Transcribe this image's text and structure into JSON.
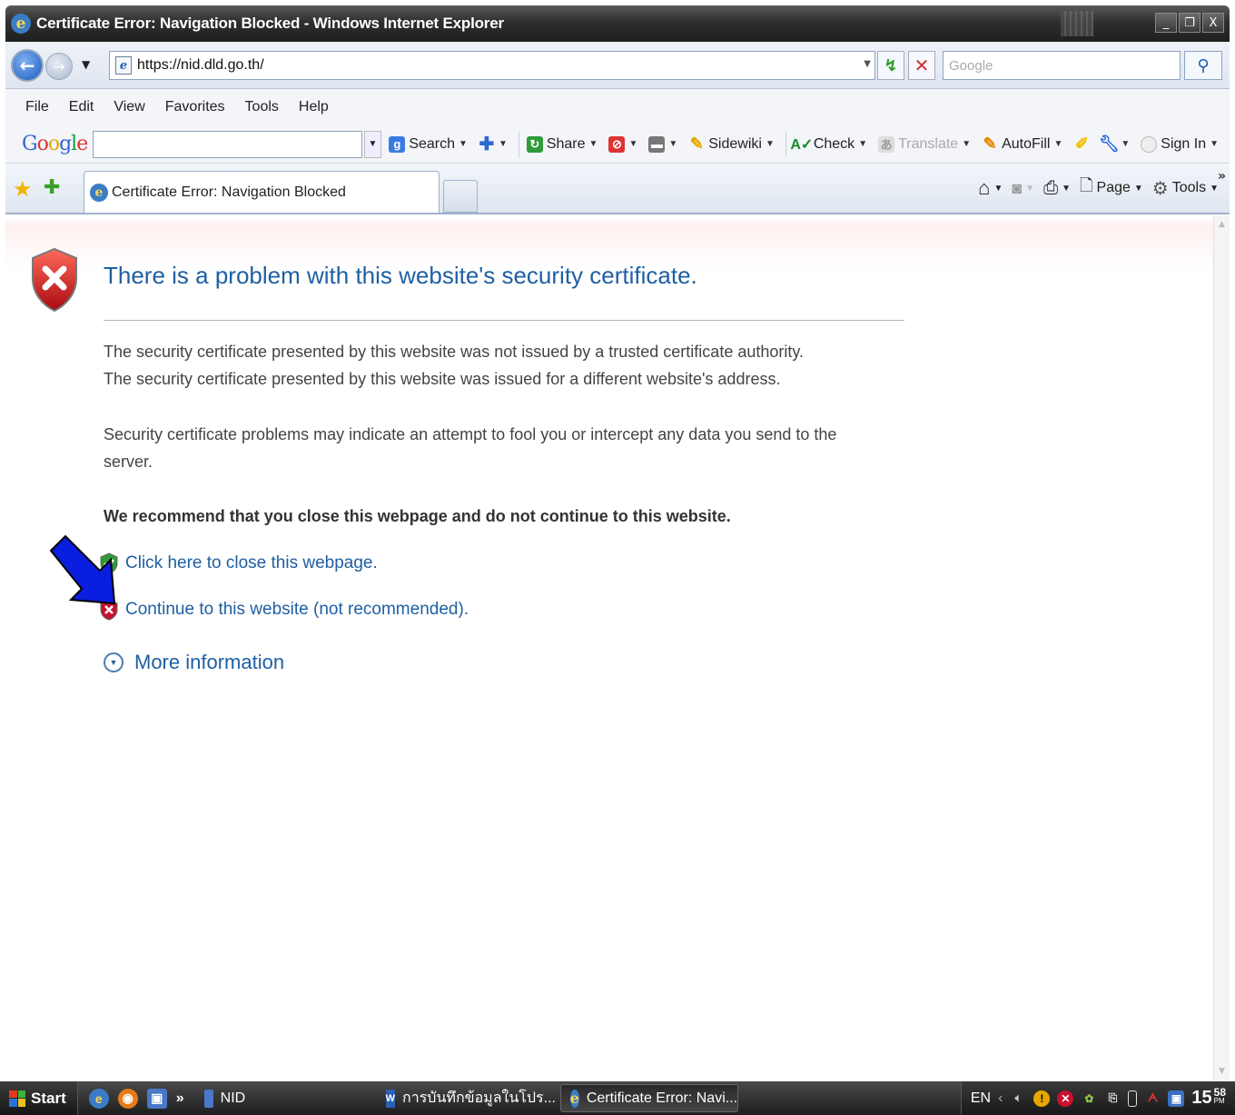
{
  "window": {
    "title": "Certificate Error: Navigation Blocked - Windows Internet Explorer",
    "minimize": "_",
    "restore": "❐",
    "close": "X"
  },
  "address_bar": {
    "url": "https://nid.dld.go.th/",
    "search_placeholder": "Google"
  },
  "menu": [
    "File",
    "Edit",
    "View",
    "Favorites",
    "Tools",
    "Help"
  ],
  "google_toolbar": {
    "logo": "Google",
    "items": {
      "search": "Search",
      "share": "Share",
      "sidewiki": "Sidewiki",
      "check": "Check",
      "translate": "Translate",
      "autofill": "AutoFill",
      "signin": "Sign In"
    }
  },
  "tab_bar": {
    "active_tab": "Certificate Error: Navigation Blocked",
    "commands": {
      "page": "Page",
      "tools": "Tools"
    },
    "overflow": "»"
  },
  "content": {
    "headline": "There is a problem with this website's security certificate.",
    "para1": "The security certificate presented by this website was not issued by a trusted certificate authority.",
    "para2": "The security certificate presented by this website was issued for a different website's address.",
    "para3": "Security certificate problems may indicate an attempt to fool you or intercept any data you send to the server.",
    "recommend": "We recommend that you close this webpage and do not continue to this website.",
    "close_link": "Click here to close this webpage.",
    "continue_link": "Continue to this website (not recommended).",
    "more_info": "More information"
  },
  "taskbar": {
    "start": "Start",
    "quicklaunch_more": "»",
    "buttons": {
      "nid": "NID",
      "word": "การบันทึกข้อมูลในโปร...",
      "cert": "Certificate Error: Navi..."
    },
    "tray": {
      "lang": "EN",
      "time_hour_min": "15",
      "time_sup_min": "58",
      "time_ampm": "PM"
    }
  },
  "colors": {
    "link": "#1f5fa3",
    "error_red": "#c8102e",
    "ok_green": "#2e9a3a",
    "arrow_blue": "#0a1ee0"
  }
}
